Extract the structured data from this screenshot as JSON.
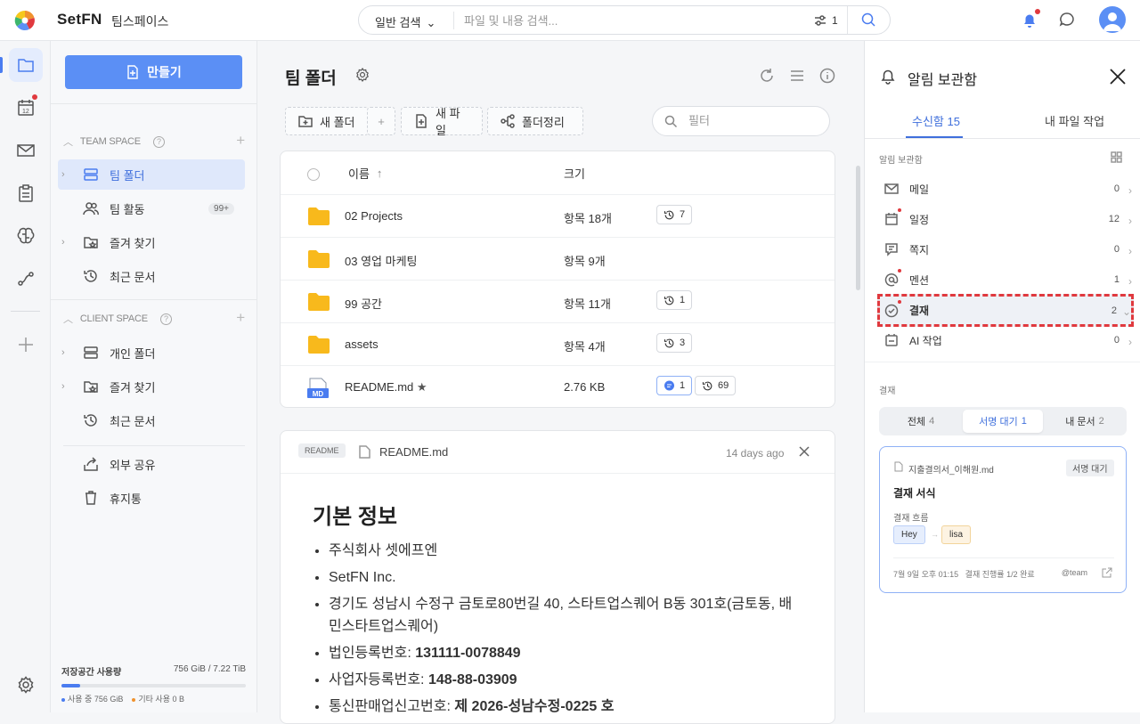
{
  "header": {
    "brand": "SetFN",
    "workspace": "팀스페이스",
    "search_mode": "일반 검색",
    "search_placeholder": "파일 및 내용 검색...",
    "filter_count": "1"
  },
  "sidebar": {
    "create_label": "만들기",
    "team_space_label": "TEAM SPACE",
    "client_space_label": "CLIENT SPACE",
    "team_items": [
      {
        "label": "팀 폴더",
        "icon": "server-icon"
      },
      {
        "label": "팀 활동",
        "icon": "people-icon",
        "badge": "99+"
      },
      {
        "label": "즐겨 찾기",
        "icon": "star-folder-icon"
      },
      {
        "label": "최근 문서",
        "icon": "history-icon"
      }
    ],
    "client_items": [
      {
        "label": "개인 폴더",
        "icon": "server-icon"
      },
      {
        "label": "즐겨 찾기",
        "icon": "star-folder-icon"
      },
      {
        "label": "최근 문서",
        "icon": "history-icon"
      }
    ],
    "extra_items": [
      {
        "label": "외부 공유",
        "icon": "share-icon"
      },
      {
        "label": "휴지통",
        "icon": "trash-icon"
      }
    ],
    "storage": {
      "label": "저장공간 사용량",
      "value": "756 GiB / 7.22 TiB",
      "used_label": "사용 중 756 GiB",
      "other_label": "기타 사용 0 B",
      "used_fraction": 0.1
    }
  },
  "main": {
    "title": "팀 폴더",
    "toolbar": {
      "new_folder": "새 폴더",
      "new_file": "새 파일",
      "organize": "폴더정리",
      "filter_placeholder": "필터"
    },
    "columns": {
      "name": "이름",
      "size": "크기"
    },
    "rows": [
      {
        "name": "02 Projects",
        "size": "항목 18개",
        "history": "7"
      },
      {
        "name": "03 영업 마케팅",
        "size": "항목 9개"
      },
      {
        "name": "99 공간",
        "size": "항목 11개",
        "history": "1"
      },
      {
        "name": "assets",
        "size": "항목 4개",
        "history": "3"
      },
      {
        "name": "README.md",
        "size": "2.76 KB",
        "comments": "1",
        "history": "69",
        "file_badge": "MD"
      }
    ],
    "readme": {
      "tag": "README",
      "file": "README.md",
      "time": "14 days ago",
      "heading": "기본 정보",
      "items": [
        {
          "text": "주식회사 셋에프엔"
        },
        {
          "text": "SetFN Inc."
        },
        {
          "text": "경기도 성남시 수정구 금토로80번길 40, 스타트업스퀘어 B동 301호(금토동, 배민스타트업스퀘어)"
        },
        {
          "label": "법인등록번호: ",
          "value": "131111-0078849"
        },
        {
          "label": "사업자등록번호: ",
          "value": "148-88-03909"
        },
        {
          "label": "통신판매업신고번호: ",
          "value": "제 2026-성남수정-0225 호"
        }
      ]
    }
  },
  "panel": {
    "title": "알림 보관함",
    "tabs": [
      {
        "label": "수신함",
        "count": "15"
      },
      {
        "label": "내 파일 작업"
      }
    ],
    "section_label": "알림 보관함",
    "notifications": [
      {
        "label": "메일",
        "count": "0",
        "icon": "mail-icon"
      },
      {
        "label": "일정",
        "count": "12",
        "icon": "calendar-icon",
        "dot": true
      },
      {
        "label": "쪽지",
        "count": "0",
        "icon": "message-icon"
      },
      {
        "label": "멘션",
        "count": "1",
        "icon": "at-icon",
        "dot": true
      },
      {
        "label": "결재",
        "count": "2",
        "icon": "approval-icon",
        "dot": true,
        "selected": true
      },
      {
        "label": "AI 작업",
        "count": "0",
        "icon": "ai-icon"
      }
    ],
    "approval_label": "결재",
    "segments": [
      {
        "label": "전체",
        "count": "4"
      },
      {
        "label": "서명 대기",
        "count": "1"
      },
      {
        "label": "내 문서",
        "count": "2"
      }
    ],
    "card": {
      "file": "지출결의서_이해원.md",
      "status": "서명 대기",
      "title": "결재 서식",
      "flow_label": "결재 흐름",
      "approvers": [
        "Hey",
        "lisa"
      ],
      "date": "7월 9일 오후 01:15",
      "progress": "결재 진행률 1/2 완료",
      "mention": "@team"
    }
  },
  "colors": {
    "accent": "#5b8ff5",
    "alert": "#e0393e",
    "folder": "#f8b91c"
  }
}
